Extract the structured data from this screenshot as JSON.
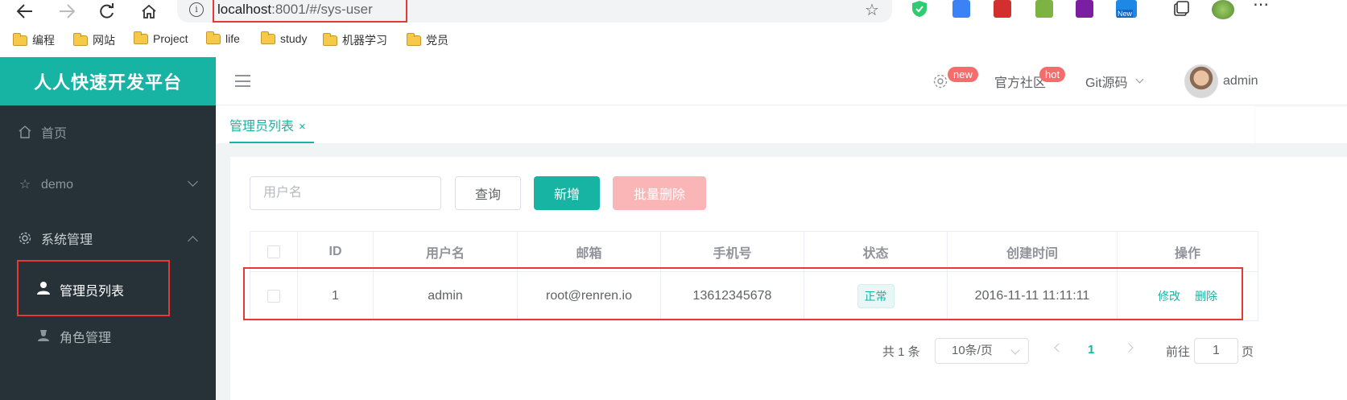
{
  "browser": {
    "url_host": "localhost",
    "url_rest": ":8001/#/sys-user",
    "bookmarks": [
      "编程",
      "网站",
      "Project",
      "life",
      "study",
      "机器学习",
      "党员"
    ],
    "ext_new_label": "New"
  },
  "app": {
    "brand": "人人快速开发平台",
    "sidebar": {
      "items": [
        {
          "label": "首页",
          "icon": "home-icon"
        },
        {
          "label": "demo",
          "icon": "star-icon"
        },
        {
          "label": "系统管理",
          "icon": "gear-icon"
        }
      ],
      "sub_items": [
        {
          "label": "管理员列表",
          "icon": "user-icon",
          "active": true
        },
        {
          "label": "角色管理",
          "icon": "role-icon",
          "active": false
        }
      ]
    },
    "topbar": {
      "settings_badge": "new",
      "community_label": "官方社区",
      "community_badge": "hot",
      "git_label": "Git源码",
      "user_name": "admin"
    },
    "tabs": [
      {
        "label": "管理员列表",
        "close": "×"
      }
    ],
    "toolbar": {
      "search_placeholder": "用户名",
      "query_label": "查询",
      "add_label": "新增",
      "batch_delete_label": "批量删除"
    },
    "table": {
      "headers": [
        "ID",
        "用户名",
        "邮箱",
        "手机号",
        "状态",
        "创建时间",
        "操作"
      ],
      "rows": [
        {
          "id": "1",
          "username": "admin",
          "email": "root@renren.io",
          "mobile": "13612345678",
          "status": "正常",
          "created": "2016-11-11 11:11:11",
          "edit": "修改",
          "delete": "删除"
        }
      ]
    },
    "pagination": {
      "total": "共 1 条",
      "page_size": "10条/页",
      "current_page": "1",
      "goto_prefix": "前往",
      "goto_value": "1",
      "goto_suffix": "页"
    }
  },
  "colors": {
    "brand": "#17b3a3",
    "sidebar_bg": "#263238",
    "danger": "#f56c6c",
    "highlight_box": "#e53935"
  }
}
